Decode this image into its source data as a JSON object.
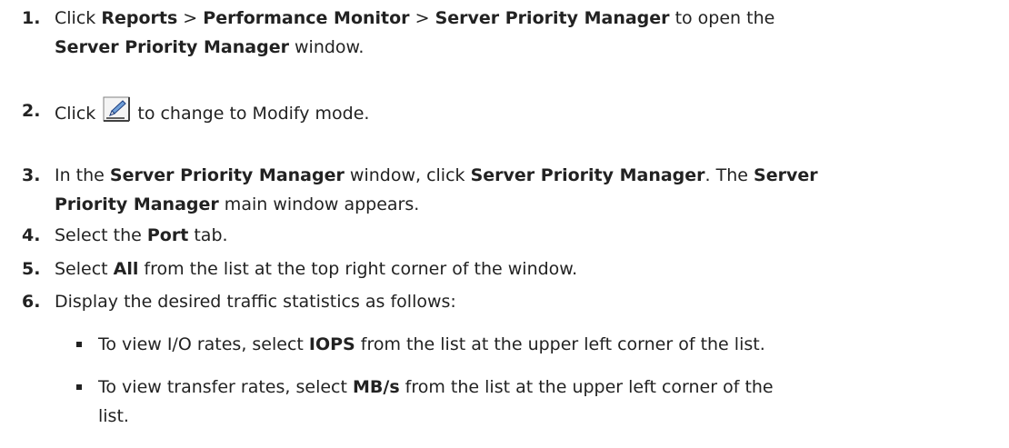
{
  "steps": [
    {
      "number": "1.",
      "t1": "Click ",
      "b1": "Reports",
      "t2": " > ",
      "b2": "Performance Monitor",
      "t3": " > ",
      "b3": "Server Priority Manager",
      "t4": " to open the",
      "b4": "Server Priority Manager",
      "t5": " window."
    },
    {
      "number": "2.",
      "t1": "Click ",
      "icon": "modify-pencil-icon",
      "t2": " to change to Modify mode."
    },
    {
      "number": "3.",
      "t1": "In the ",
      "b1": "Server Priority Manager",
      "t2": " window, click ",
      "b2": "Server Priority Manager",
      "t3": ". The ",
      "b3": "Server",
      "b4": "Priority Manager",
      "t4": " main window appears."
    },
    {
      "number": "4.",
      "t1": "Select the ",
      "b1": "Port",
      "t2": " tab."
    },
    {
      "number": "5.",
      "t1": "Select ",
      "b1": "All",
      "t2": " from the list at the top right corner of the window."
    },
    {
      "number": "6.",
      "t1": "Display the desired traffic statistics as follows:"
    }
  ],
  "bullets": [
    {
      "t1": "To view I/O rates, select ",
      "b1": "IOPS",
      "t2": " from the list at the upper left corner of the list."
    },
    {
      "t1": "To view transfer rates, select ",
      "b1": "MB/s",
      "t2": " from the list at the upper left corner of the",
      "t3": "list."
    }
  ]
}
